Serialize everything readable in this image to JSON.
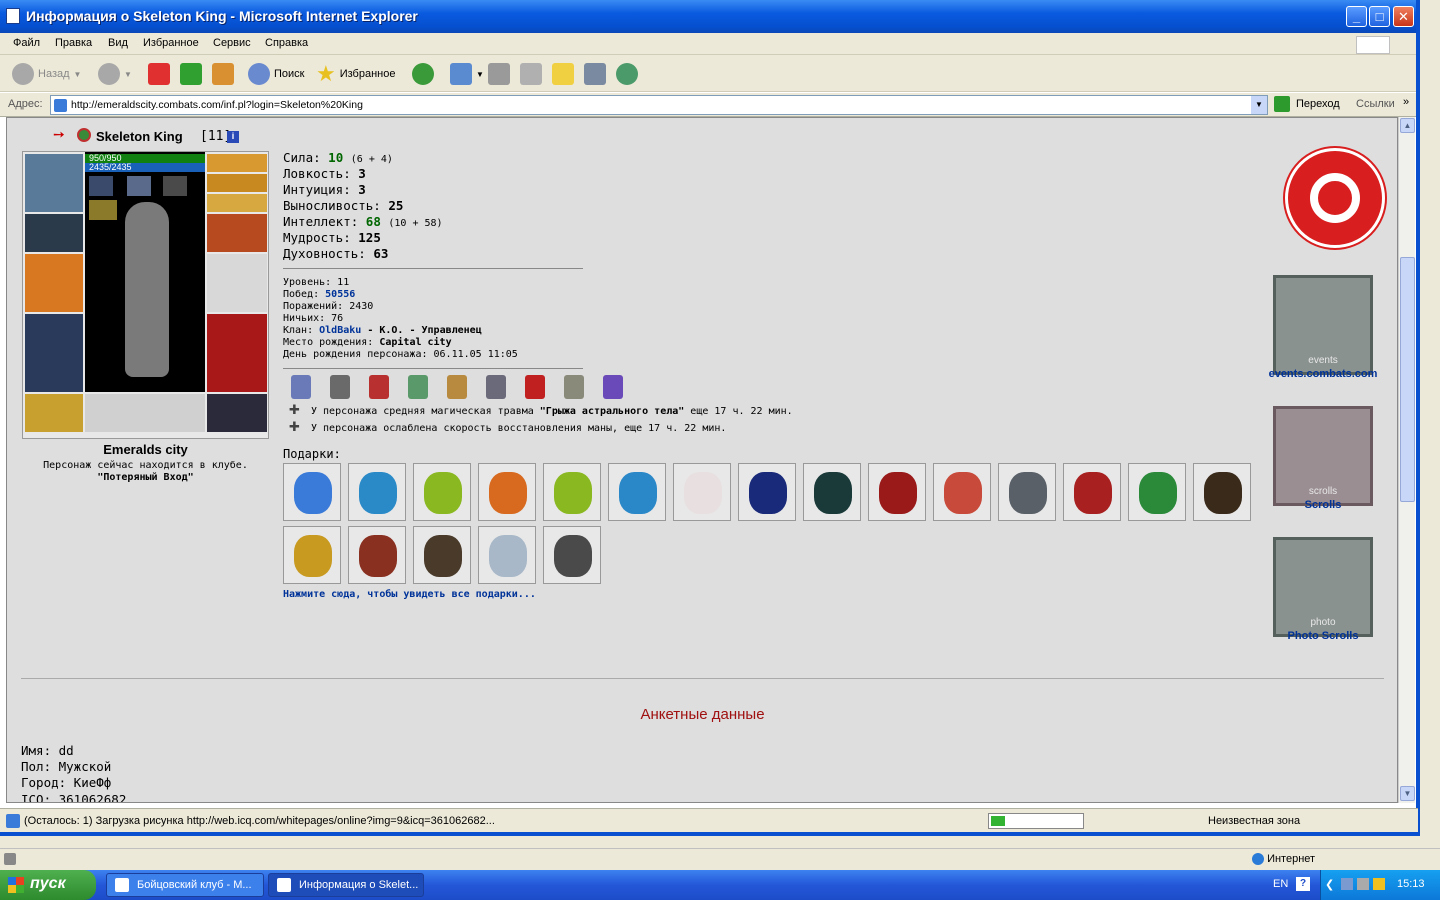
{
  "window": {
    "title": "Информация о Skeleton King - Microsoft Internet Explorer"
  },
  "menu": [
    "Файл",
    "Правка",
    "Вид",
    "Избранное",
    "Сервис",
    "Справка"
  ],
  "toolbar": {
    "back": "Назад",
    "search": "Поиск",
    "favorites": "Избранное"
  },
  "address": {
    "label": "Адрес:",
    "url": "http://emeraldscity.combats.com/inf.pl?login=Skeleton%20King",
    "go": "Переход",
    "links": "Ссылки"
  },
  "character": {
    "name": "Skeleton King",
    "level": "[11]",
    "hp": "950/950",
    "mana": "2435/2435",
    "city": "Emeralds city",
    "location_text": "Персонаж сейчас находится в клубе.",
    "location_room": "\"Потеряный Вход\""
  },
  "stats": [
    {
      "label": "Сила:",
      "value": "10",
      "extra": "(6 + 4)",
      "green": true
    },
    {
      "label": "Ловкость:",
      "value": "3",
      "extra": "",
      "green": false
    },
    {
      "label": "Интуиция:",
      "value": "3",
      "extra": "",
      "green": false
    },
    {
      "label": "Выносливость:",
      "value": "25",
      "extra": "",
      "green": false
    },
    {
      "label": "Интеллект:",
      "value": "68",
      "extra": "(10 + 58)",
      "green": true
    },
    {
      "label": "Мудрость:",
      "value": "125",
      "extra": "",
      "green": false
    },
    {
      "label": "Духовность:",
      "value": "63",
      "extra": "",
      "green": false
    }
  ],
  "info": {
    "level": "Уровень: 11",
    "wins_label": "Побед:",
    "wins": "50556",
    "losses": "Поражений: 2430",
    "draws": "Ничьих: 76",
    "clan_label": "Клан:",
    "clan": "OldBaku",
    "clan_rest": "- К.О. - Управленец",
    "birthplace_label": "Место рождения:",
    "birthplace": "Capital city",
    "birthday": "День рождения персонажа: 06.11.05 11:05"
  },
  "effects": [
    {
      "pre": "У персонажа средняя магическая травма ",
      "bold": "\"Грыжа астрального тела\"",
      "post": " еще 17 ч. 22 мин."
    },
    {
      "pre": "У персонажа ослаблена скорость восстановления маны, еще 17 ч. 22 мин.",
      "bold": "",
      "post": ""
    }
  ],
  "gifts_label": "Подарки:",
  "gifts_link": "Нажмите сюда, чтобы увидеть все подарки...",
  "gift_colors_row1": [
    "#3a7ad8",
    "#2a8ac8",
    "#8ab820",
    "#d86a20",
    "#8ab820",
    "#2a88c8",
    "#e8e0e0",
    "#1a2a7a",
    "#1a3a3a",
    "#9a1a1a",
    "#c84a3a",
    "#5a6068",
    "#a82020",
    "#2a8a3a",
    "#3a2a1a"
  ],
  "gift_colors_row2": [
    "#c89a20",
    "#8a3020",
    "#4a3a2a",
    "#a8b8c8",
    "#4a4a4a"
  ],
  "badge_colors": [
    "#6a7ab8",
    "#6a6a6a",
    "#b83030",
    "#5a9a6a",
    "#b88a40",
    "#6a6a7a",
    "#c02020",
    "#8a8a7a",
    "#6a4ab8"
  ],
  "sidebar": {
    "events": "events.combats.com",
    "scrolls": "Scrolls",
    "photo": "Photo Scrolls",
    "events_text": "events",
    "scrolls_text": "scrolls",
    "photo_text": "photo"
  },
  "profile": {
    "heading": "Анкетные данные",
    "name": "Имя: dd",
    "gender": "Пол: Мужской",
    "city": "Город: КиеФф",
    "icq": "ICQ: 361062682"
  },
  "status": {
    "text": "(Осталось: 1) Загрузка рисунка http://web.icq.com/whitepages/online?img=9&icq=361062682...",
    "zone": "Неизвестная зона",
    "progress": 0.15,
    "internet": "Интернет"
  },
  "taskbar": {
    "start": "пуск",
    "tasks": [
      "Бойцовский клуб - М...",
      "Информация о Skelet..."
    ],
    "lang": "EN",
    "time": "15:13"
  }
}
